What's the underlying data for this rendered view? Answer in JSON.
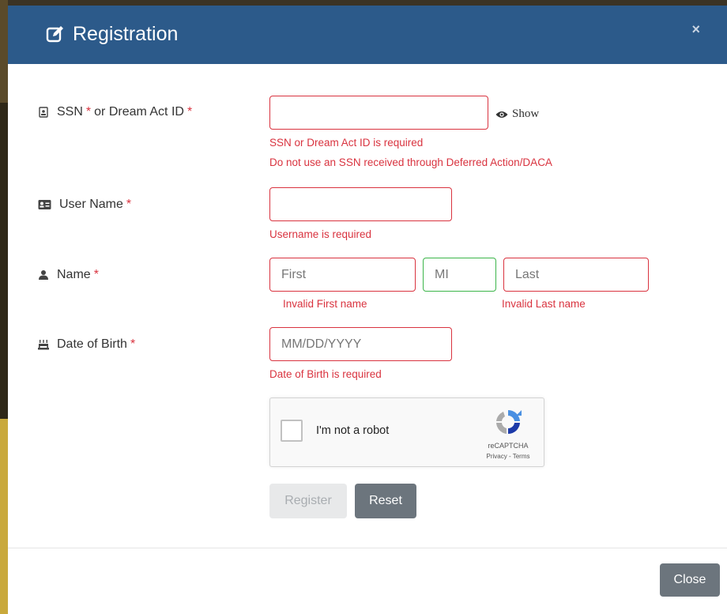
{
  "modal": {
    "title": "Registration",
    "close_x": "×"
  },
  "form": {
    "ssn": {
      "label": "SSN",
      "label_mid": "or Dream Act ID",
      "required_mark": "*",
      "value": "",
      "show_label": "Show",
      "errors": [
        "SSN or Dream Act ID is required",
        "Do not use an SSN received through Deferred Action/DACA"
      ]
    },
    "username": {
      "label": "User Name",
      "required_mark": "*",
      "value": "",
      "error": "Username is required"
    },
    "name": {
      "label": "Name",
      "required_mark": "*",
      "first_placeholder": "First",
      "mi_placeholder": "MI",
      "last_placeholder": "Last",
      "first_error": "Invalid First name",
      "last_error": "Invalid Last name"
    },
    "dob": {
      "label": "Date of Birth",
      "required_mark": "*",
      "placeholder": "MM/DD/YYYY",
      "error": "Date of Birth is required"
    },
    "captcha": {
      "label": "I'm not a robot",
      "brand": "reCAPTCHA",
      "links": "Privacy - Terms"
    }
  },
  "buttons": {
    "register": "Register",
    "reset": "Reset",
    "close": "Close"
  },
  "colors": {
    "header": "#2c5a8a",
    "error": "#d9333f",
    "valid": "#3cb54a",
    "secondary_button": "#6c757d"
  },
  "icons": {
    "title": "edit-icon",
    "ssn": "id-badge-icon",
    "username": "id-card-icon",
    "name": "user-icon",
    "dob": "birthday-cake-icon",
    "show": "eye-icon"
  }
}
